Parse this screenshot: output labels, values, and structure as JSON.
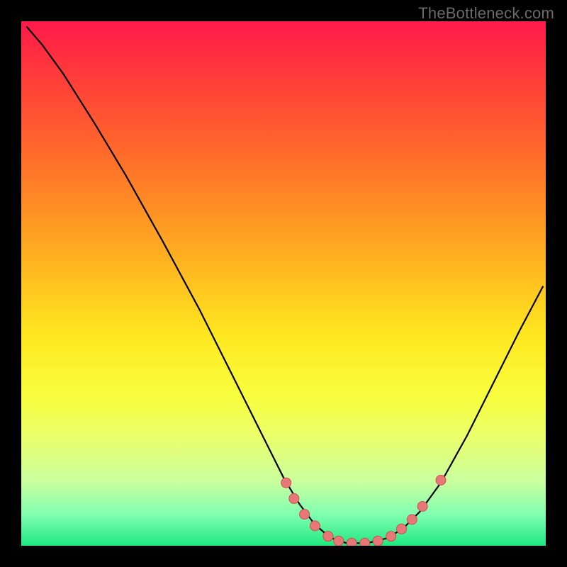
{
  "watermark": "TheBottleneck.com",
  "colors": {
    "bg": "#000000",
    "gradient_top": "#ff1a4a",
    "gradient_bottom": "#20e880",
    "curve": "#000000",
    "marker_fill": "#e87878",
    "marker_stroke": "#cc5050"
  },
  "chart_data": {
    "type": "line",
    "title": "",
    "xlabel": "",
    "ylabel": "",
    "xlim": [
      0,
      100
    ],
    "ylim": [
      0,
      100
    ],
    "curve_points": [
      {
        "x": 1.0,
        "y": 99.0
      },
      {
        "x": 4.0,
        "y": 95.5
      },
      {
        "x": 8.0,
        "y": 90.0
      },
      {
        "x": 14.0,
        "y": 80.5
      },
      {
        "x": 20.0,
        "y": 70.5
      },
      {
        "x": 27.0,
        "y": 58.0
      },
      {
        "x": 34.0,
        "y": 45.0
      },
      {
        "x": 40.0,
        "y": 33.0
      },
      {
        "x": 46.0,
        "y": 21.0
      },
      {
        "x": 50.0,
        "y": 13.0
      },
      {
        "x": 53.0,
        "y": 8.0
      },
      {
        "x": 56.0,
        "y": 4.0
      },
      {
        "x": 59.0,
        "y": 1.5
      },
      {
        "x": 62.0,
        "y": 0.5
      },
      {
        "x": 66.0,
        "y": 0.5
      },
      {
        "x": 70.0,
        "y": 1.5
      },
      {
        "x": 73.0,
        "y": 3.5
      },
      {
        "x": 76.0,
        "y": 6.5
      },
      {
        "x": 80.0,
        "y": 12.0
      },
      {
        "x": 85.0,
        "y": 21.0
      },
      {
        "x": 90.0,
        "y": 31.0
      },
      {
        "x": 95.0,
        "y": 41.0
      },
      {
        "x": 99.5,
        "y": 49.5
      }
    ],
    "markers": [
      {
        "x": 50.5,
        "y": 12.0
      },
      {
        "x": 52.0,
        "y": 9.0
      },
      {
        "x": 54.0,
        "y": 6.0
      },
      {
        "x": 56.0,
        "y": 3.8
      },
      {
        "x": 58.5,
        "y": 1.8
      },
      {
        "x": 60.5,
        "y": 0.9
      },
      {
        "x": 63.0,
        "y": 0.5
      },
      {
        "x": 65.5,
        "y": 0.5
      },
      {
        "x": 68.0,
        "y": 0.9
      },
      {
        "x": 70.5,
        "y": 1.8
      },
      {
        "x": 72.5,
        "y": 3.2
      },
      {
        "x": 74.5,
        "y": 5.0
      },
      {
        "x": 76.5,
        "y": 7.5
      },
      {
        "x": 80.0,
        "y": 12.5
      }
    ]
  }
}
